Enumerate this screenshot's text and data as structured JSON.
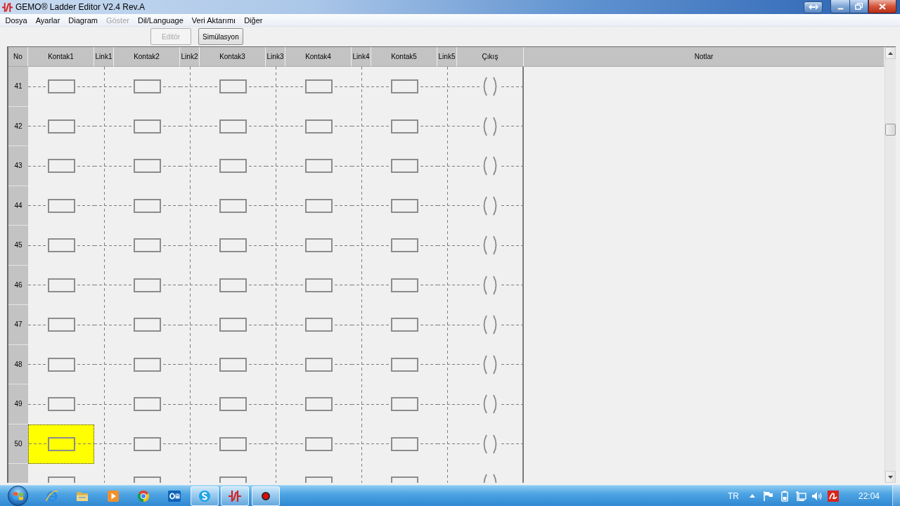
{
  "window": {
    "title": "GEMO® Ladder Editor V2.4 Rev.A"
  },
  "menu": [
    {
      "label": "Dosya",
      "disabled": false
    },
    {
      "label": "Ayarlar",
      "disabled": false
    },
    {
      "label": "Diagram",
      "disabled": false
    },
    {
      "label": "Göster",
      "disabled": true
    },
    {
      "label": "Dil/Language",
      "disabled": false
    },
    {
      "label": "Veri Aktarımı",
      "disabled": false
    },
    {
      "label": "Diğer",
      "disabled": false
    }
  ],
  "toolbar": [
    {
      "label": "Editör",
      "disabled": true
    },
    {
      "label": "Simülasyon",
      "disabled": false
    }
  ],
  "table": {
    "columns": [
      "No",
      "Kontak1",
      "Link1",
      "Kontak2",
      "Link2",
      "Kontak3",
      "Link3",
      "Kontak4",
      "Link4",
      "Kontak5",
      "Link5",
      "Çıkış",
      "Notlar"
    ],
    "rows": [
      {
        "no": "41",
        "contacts": [
          {
            "selected": false
          },
          {
            "selected": false
          },
          {
            "selected": false
          },
          {
            "selected": false
          },
          {
            "selected": false
          }
        ]
      },
      {
        "no": "42",
        "contacts": [
          {
            "selected": false
          },
          {
            "selected": false
          },
          {
            "selected": false
          },
          {
            "selected": false
          },
          {
            "selected": false
          }
        ]
      },
      {
        "no": "43",
        "contacts": [
          {
            "selected": false
          },
          {
            "selected": false
          },
          {
            "selected": false
          },
          {
            "selected": false
          },
          {
            "selected": false
          }
        ]
      },
      {
        "no": "44",
        "contacts": [
          {
            "selected": false
          },
          {
            "selected": false
          },
          {
            "selected": false
          },
          {
            "selected": false
          },
          {
            "selected": false
          }
        ]
      },
      {
        "no": "45",
        "contacts": [
          {
            "selected": false
          },
          {
            "selected": false
          },
          {
            "selected": false
          },
          {
            "selected": false
          },
          {
            "selected": false
          }
        ]
      },
      {
        "no": "46",
        "contacts": [
          {
            "selected": false
          },
          {
            "selected": false
          },
          {
            "selected": false
          },
          {
            "selected": false
          },
          {
            "selected": false
          }
        ]
      },
      {
        "no": "47",
        "contacts": [
          {
            "selected": false
          },
          {
            "selected": false
          },
          {
            "selected": false
          },
          {
            "selected": false
          },
          {
            "selected": false
          }
        ]
      },
      {
        "no": "48",
        "contacts": [
          {
            "selected": false
          },
          {
            "selected": false
          },
          {
            "selected": false
          },
          {
            "selected": false
          },
          {
            "selected": false
          }
        ]
      },
      {
        "no": "49",
        "contacts": [
          {
            "selected": false
          },
          {
            "selected": false
          },
          {
            "selected": false
          },
          {
            "selected": false
          },
          {
            "selected": false
          }
        ]
      },
      {
        "no": "50",
        "contacts": [
          {
            "selected": true
          },
          {
            "selected": false
          },
          {
            "selected": false
          },
          {
            "selected": false
          },
          {
            "selected": false
          }
        ]
      },
      {
        "contacts": [
          {
            "selected": false
          },
          {
            "selected": false
          },
          {
            "selected": false
          },
          {
            "selected": false
          },
          {
            "selected": false
          }
        ]
      }
    ]
  },
  "taskbar": {
    "apps": [
      {
        "open": false
      },
      {
        "open": false
      },
      {
        "open": false
      },
      {
        "open": false
      },
      {
        "open": false
      },
      {
        "open": true
      },
      {
        "open": true
      },
      {
        "open": true
      }
    ],
    "language": "TR",
    "clock": "22:04"
  }
}
